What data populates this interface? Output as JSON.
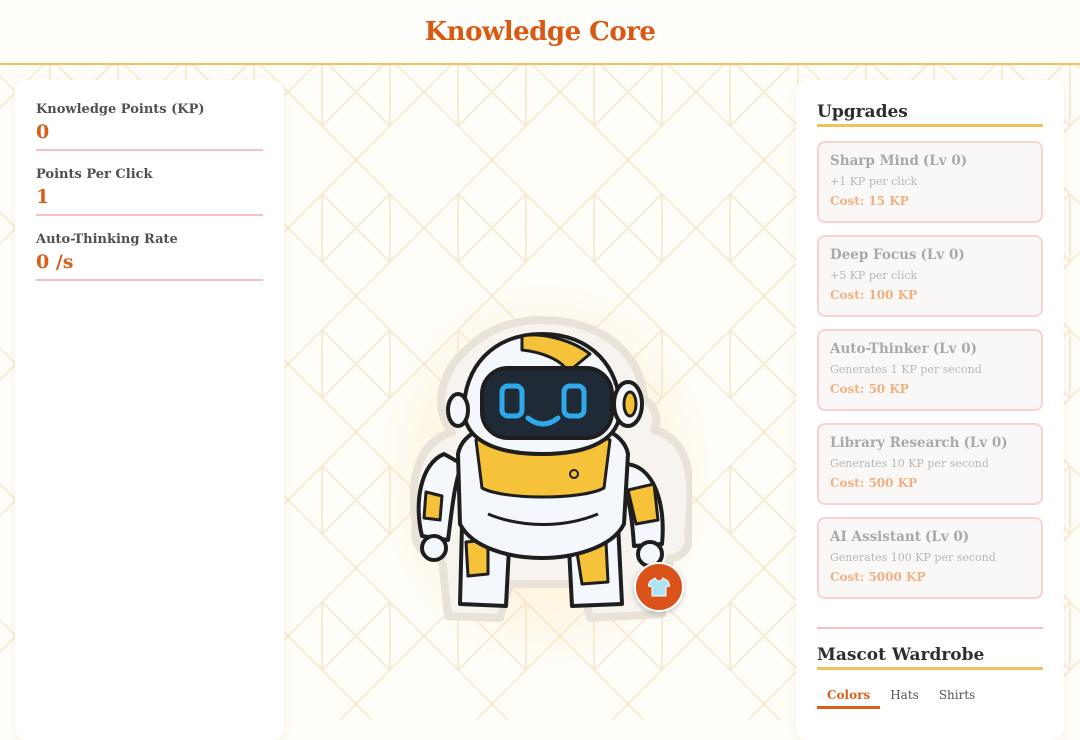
{
  "header": {
    "title": "Knowledge Core"
  },
  "stats": [
    {
      "label": "Knowledge Points (KP)",
      "value": "0"
    },
    {
      "label": "Points Per Click",
      "value": "1"
    },
    {
      "label": "Auto-Thinking Rate",
      "value": "0 /s"
    }
  ],
  "upgrades": {
    "title": "Upgrades",
    "items": [
      {
        "name": "Sharp Mind",
        "level": "(Lv 0)",
        "desc": "+1 KP per click",
        "cost": "Cost: 15 KP"
      },
      {
        "name": "Deep Focus",
        "level": "(Lv 0)",
        "desc": "+5 KP per click",
        "cost": "Cost: 100 KP"
      },
      {
        "name": "Auto-Thinker",
        "level": "(Lv 0)",
        "desc": "Generates 1 KP per second",
        "cost": "Cost: 50 KP"
      },
      {
        "name": "Library Research",
        "level": "(Lv 0)",
        "desc": "Generates 10 KP per second",
        "cost": "Cost: 500 KP"
      },
      {
        "name": "AI Assistant",
        "level": "(Lv 0)",
        "desc": "Generates 100 KP per second",
        "cost": "Cost: 5000 KP"
      }
    ]
  },
  "wardrobe": {
    "title": "Mascot Wardrobe",
    "tabs": [
      "Colors",
      "Hats",
      "Shirts"
    ],
    "active_tab": "Colors"
  },
  "mascot": {
    "button_icon": "shirt-icon"
  },
  "colors": {
    "accent": "#d8601a",
    "header_rule": "#f2c25a",
    "card_border": "#f7d2d0",
    "face_glow": "#2aa3e0"
  }
}
